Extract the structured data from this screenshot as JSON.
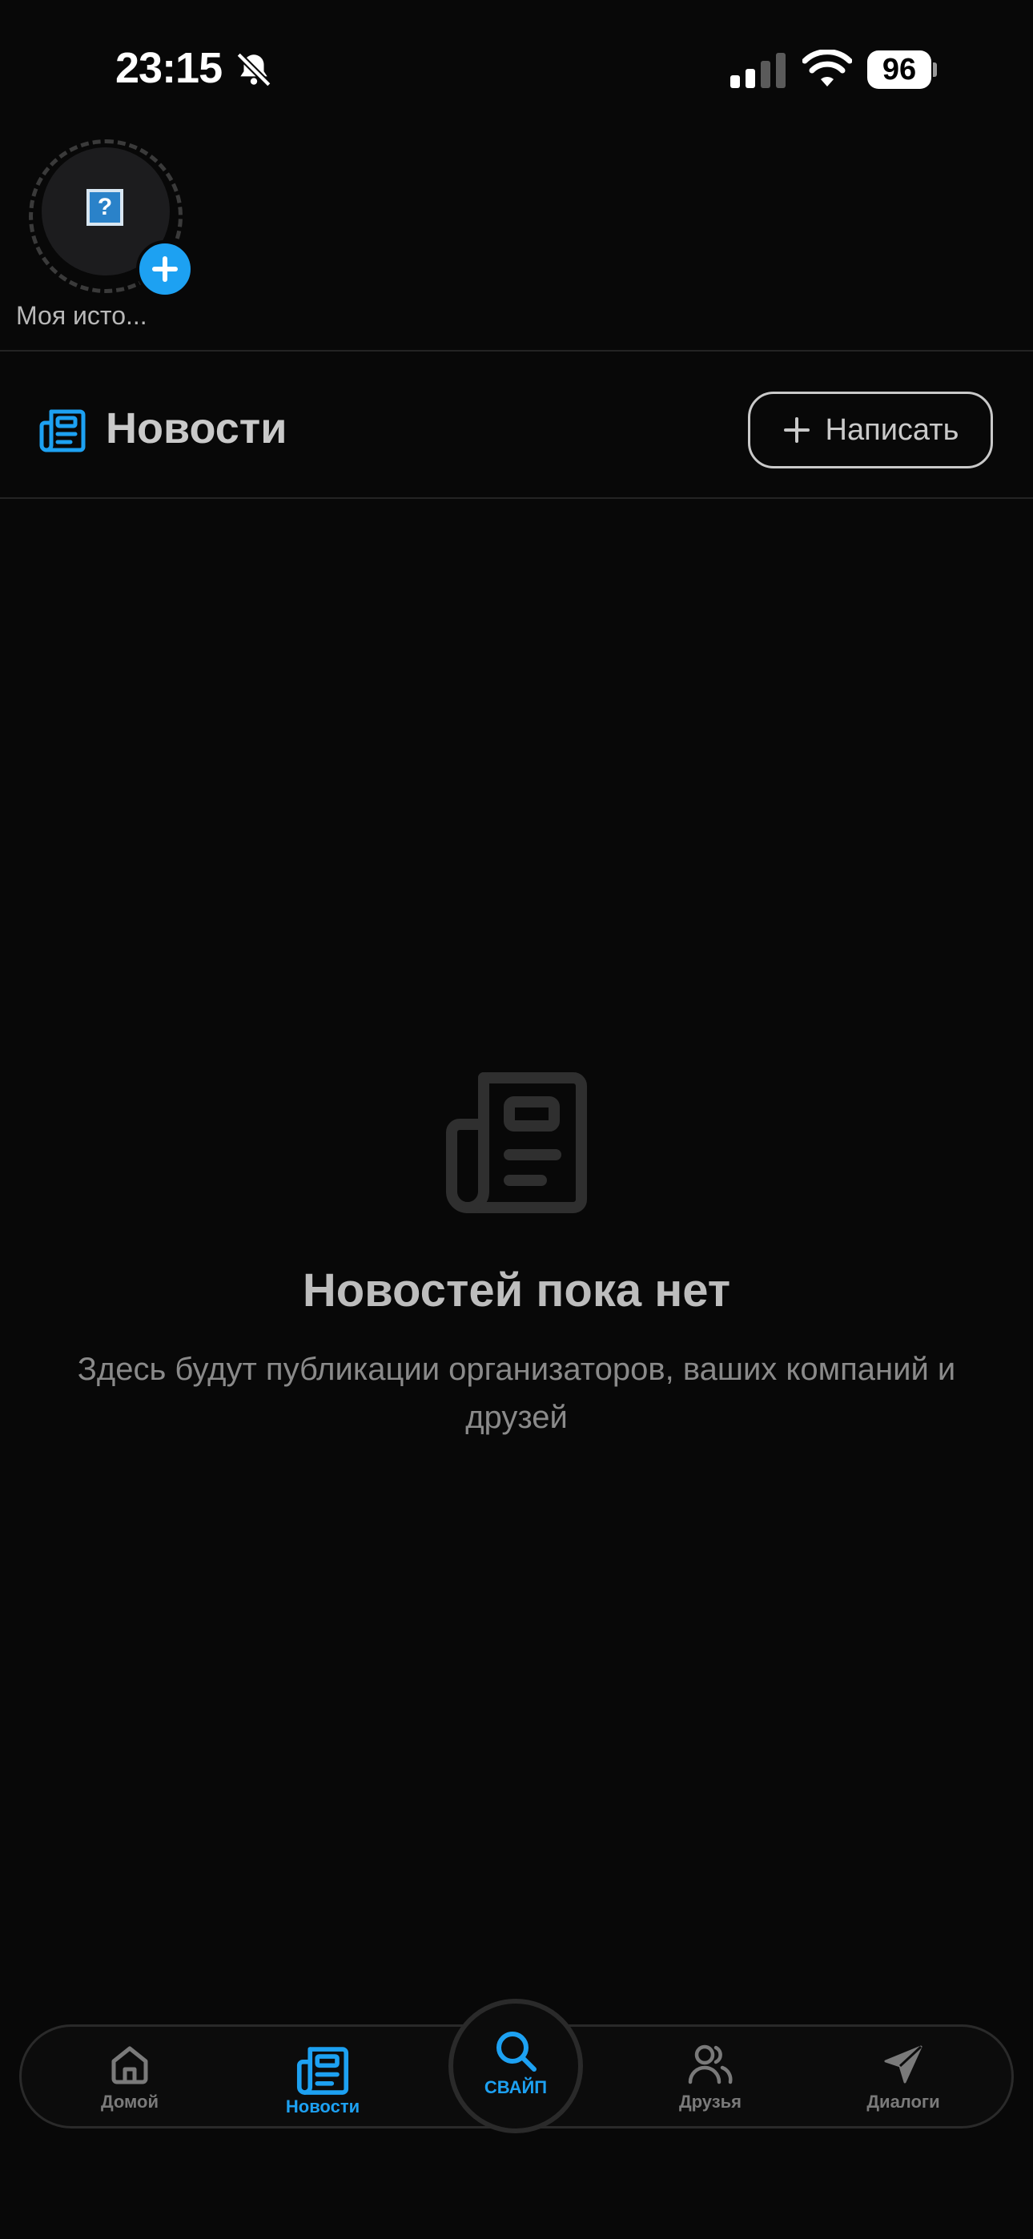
{
  "status_bar": {
    "time": "23:15",
    "battery": "96"
  },
  "stories": {
    "my_story_label": "Моя исто...",
    "placeholder_glyph": "?"
  },
  "header": {
    "title": "Новости",
    "compose_label": "Написать"
  },
  "empty_state": {
    "title": "Новостей пока нет",
    "subtitle": "Здесь будут публикации организаторов, ваших компаний и друзей"
  },
  "tab_bar": {
    "tabs": [
      {
        "label": "Домой",
        "icon": "home-icon",
        "active": false
      },
      {
        "label": "Новости",
        "icon": "newspaper-icon",
        "active": true
      },
      {
        "label": "СВАЙП",
        "icon": "search-icon",
        "active": false
      },
      {
        "label": "Друзья",
        "icon": "friends-icon",
        "active": false
      },
      {
        "label": "Диалоги",
        "icon": "send-icon",
        "active": false
      }
    ]
  },
  "colors": {
    "accent": "#1da1f2",
    "background": "#080808"
  }
}
